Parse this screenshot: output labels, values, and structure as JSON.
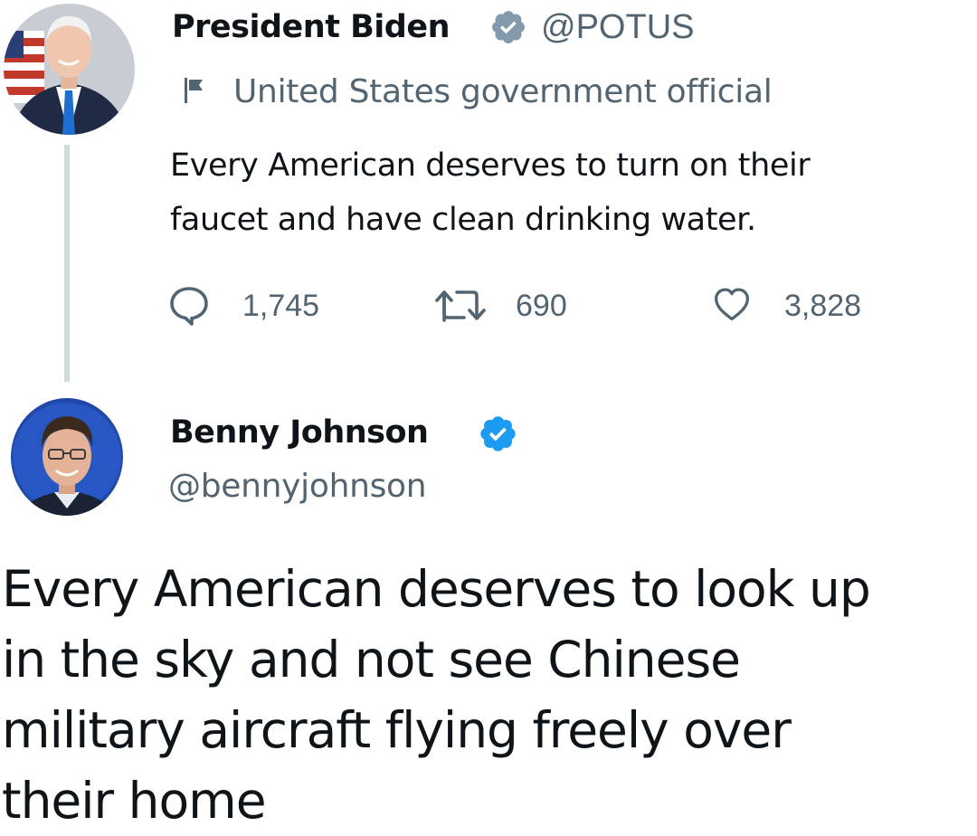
{
  "thread": {
    "parent_tweet": {
      "display_name": "President Biden",
      "handle": "@POTUS",
      "verified_color": "#829aab",
      "label_icon": "flag-icon",
      "account_label": "United States government official",
      "text_lines": [
        "Every American deserves to turn on their",
        "faucet and have clean drinking water."
      ],
      "actions": {
        "reply_icon": "reply-icon",
        "reply_count": "1,745",
        "retweet_icon": "retweet-icon",
        "retweet_count": "690",
        "like_icon": "heart-icon",
        "like_count": "3,828"
      }
    },
    "reply_tweet": {
      "display_name": "Benny Johnson",
      "handle": "@bennyjohnson",
      "verified_color": "#1d9bf0",
      "text_lines": [
        "Every American deserves to look up",
        "in the sky and not see Chinese",
        "military aircraft flying freely over",
        "their home"
      ]
    }
  },
  "colors": {
    "text_primary": "#0f1419",
    "text_secondary": "#536471",
    "thread_line": "#cfd9de"
  }
}
